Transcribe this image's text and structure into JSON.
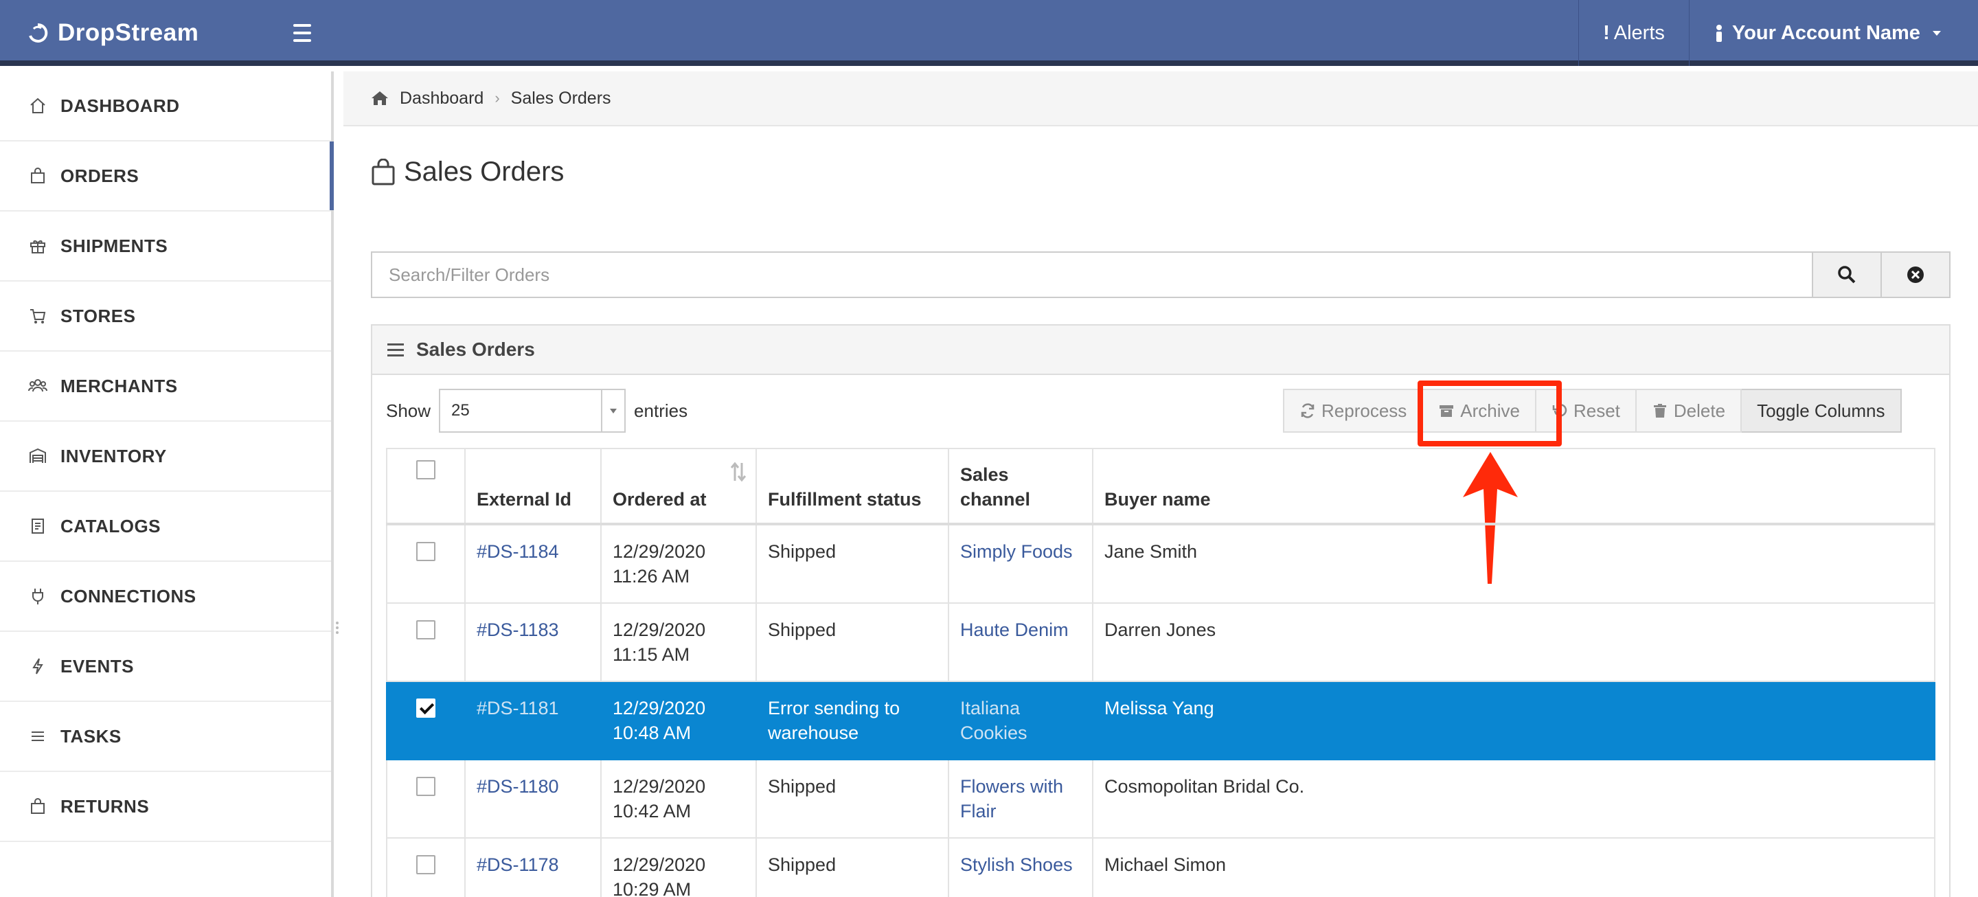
{
  "app": {
    "brand": "DropStream"
  },
  "topbar": {
    "alerts_label": "Alerts",
    "account_label": "Your Account Name"
  },
  "sidebar": {
    "items": [
      {
        "label": "DASHBOARD",
        "icon": "home-icon"
      },
      {
        "label": "ORDERS",
        "icon": "shopping-bag-icon",
        "active": true
      },
      {
        "label": "SHIPMENTS",
        "icon": "gift-icon"
      },
      {
        "label": "STORES",
        "icon": "cart-icon"
      },
      {
        "label": "MERCHANTS",
        "icon": "users-icon"
      },
      {
        "label": "INVENTORY",
        "icon": "warehouse-icon"
      },
      {
        "label": "CATALOGS",
        "icon": "book-icon"
      },
      {
        "label": "CONNECTIONS",
        "icon": "plug-icon"
      },
      {
        "label": "EVENTS",
        "icon": "bolt-icon"
      },
      {
        "label": "TASKS",
        "icon": "list-icon"
      },
      {
        "label": "RETURNS",
        "icon": "shopping-bag-icon"
      }
    ]
  },
  "breadcrumb": {
    "home": "Dashboard",
    "current": "Sales Orders"
  },
  "page": {
    "title": "Sales Orders"
  },
  "search": {
    "placeholder": "Search/Filter Orders",
    "value": ""
  },
  "panel": {
    "title": "Sales Orders",
    "show_label": "Show",
    "entries_value": "25",
    "entries_label": "entries",
    "buttons": {
      "reprocess": "Reprocess",
      "archive": "Archive",
      "reset": "Reset",
      "delete": "Delete",
      "toggle": "Toggle Columns"
    }
  },
  "table": {
    "headers": {
      "external_id": "External Id",
      "ordered_at": "Ordered at",
      "fulfillment": "Fulfillment status",
      "channel": "Sales channel",
      "buyer": "Buyer name"
    },
    "rows": [
      {
        "id": "#DS-1184",
        "date": "12/29/2020",
        "time": "11:26 AM",
        "status": "Shipped",
        "channel": "Simply Foods",
        "buyer": "Jane Smith",
        "checked": false
      },
      {
        "id": "#DS-1183",
        "date": "12/29/2020",
        "time": "11:15 AM",
        "status": "Shipped",
        "channel": "Haute Denim",
        "buyer": "Darren Jones",
        "checked": false
      },
      {
        "id": "#DS-1181",
        "date": "12/29/2020",
        "time": "10:48 AM",
        "status": "Error sending to warehouse",
        "channel": "Italiana Cookies",
        "buyer": "Melissa Yang",
        "checked": true
      },
      {
        "id": "#DS-1180",
        "date": "12/29/2020",
        "time": "10:42 AM",
        "status": "Shipped",
        "channel": "Flowers with Flair",
        "buyer": "Cosmopolitan Bridal Co.",
        "checked": false
      },
      {
        "id": "#DS-1178",
        "date": "12/29/2020",
        "time": "10:29 AM",
        "status": "Shipped",
        "channel": "Stylish Shoes",
        "buyer": "Michael Simon",
        "checked": false
      }
    ]
  },
  "colors": {
    "topbar": "#4f68a0",
    "selected_row": "#0a86d1",
    "annotation": "#ff2a0a",
    "link": "#3a5a9c"
  }
}
